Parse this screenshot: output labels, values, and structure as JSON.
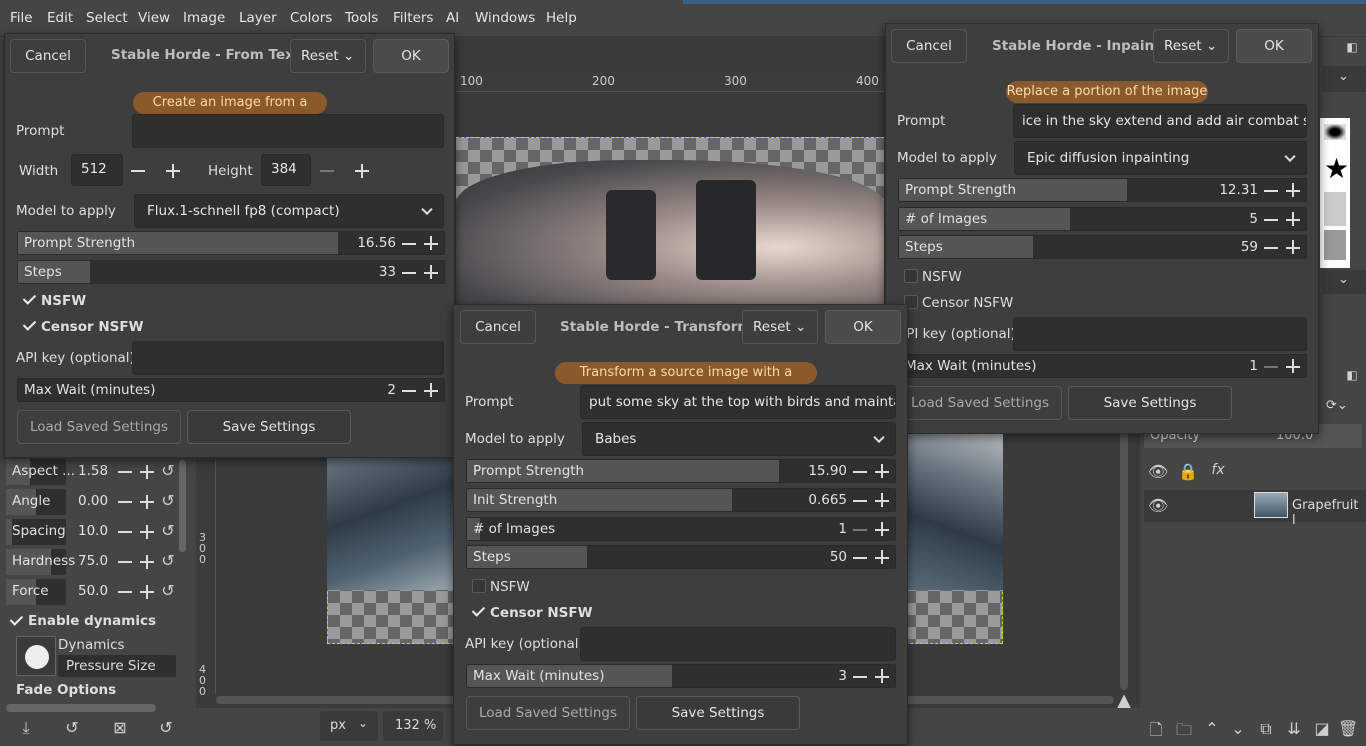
{
  "menubar": [
    "File",
    "Edit",
    "Select",
    "View",
    "Image",
    "Layer",
    "Colors",
    "Tools",
    "Filters",
    "AI",
    "Windows",
    "Help"
  ],
  "ruler": {
    "marks": [
      "100",
      "200",
      "300",
      "400"
    ],
    "vertical_marks": [
      "300",
      "400"
    ]
  },
  "statusbar": {
    "unit": "px",
    "zoom": "132 %"
  },
  "tool_options": {
    "rows": [
      {
        "label": "Aspect ...",
        "value": "1.58",
        "fill": 0.4
      },
      {
        "label": "Angle",
        "value": "0.00",
        "fill": 0.5
      },
      {
        "label": "Spacing",
        "value": "10.0",
        "fill": 0.1
      },
      {
        "label": "Hardness",
        "value": "75.0",
        "fill": 0.75
      },
      {
        "label": "Force",
        "value": "50.0",
        "fill": 0.5
      }
    ],
    "enable_dynamics": "Enable dynamics",
    "dynamics_label": "Dynamics",
    "dynamics_value": "Pressure Size",
    "fade_options": "Fade Options"
  },
  "layers": {
    "opacity_label": "Opacity",
    "opacity_value": "100.0",
    "layer_name": "Grapefruit l"
  },
  "dialog_text": {
    "cancel": "Cancel",
    "reset": "Reset",
    "ok": "OK",
    "title": "Stable Horde - From Text",
    "pill": "Create an image from a prompt",
    "prompt_label": "Prompt",
    "prompt_value": "",
    "width_label": "Width",
    "width_value": "512",
    "height_label": "Height",
    "height_value": "384",
    "model_label": "Model to apply",
    "model_value": "Flux.1-schnell fp8 (compact)",
    "prompt_strength_label": "Prompt Strength",
    "prompt_strength_value": "16.56",
    "prompt_strength_fill": 0.72,
    "steps_label": "Steps",
    "steps_value": "33",
    "steps_fill": 0.17,
    "nsfw": "NSFW",
    "censor": "Censor NSFW",
    "api_label": "API key (optional)",
    "api_value": "",
    "maxwait_label": "Max Wait (minutes)",
    "maxwait_value": "2",
    "load": "Load Saved Settings",
    "save": "Save Settings"
  },
  "dialog_inpaint": {
    "cancel": "Cancel",
    "reset": "Reset",
    "ok": "OK",
    "title": "Stable Horde - Inpaint",
    "pill": "Replace a portion of the image",
    "prompt_label": "Prompt",
    "prompt_value": "ice in the sky extend and add air combat ships",
    "model_label": "Model to apply",
    "model_value": "Epic diffusion inpainting",
    "prompt_strength_label": "Prompt Strength",
    "prompt_strength_value": "12.31",
    "prompt_strength_fill": 0.56,
    "images_label": "# of Images",
    "images_value": "5",
    "images_fill": 0.42,
    "steps_label": "Steps",
    "steps_value": "59",
    "steps_fill": 0.33,
    "nsfw": "NSFW",
    "censor": "Censor NSFW",
    "api_label": "API key (optional)",
    "api_value": "",
    "maxwait_label": "Max Wait (minutes)",
    "maxwait_value": "1",
    "load": "Load Saved Settings",
    "save": "Save Settings"
  },
  "dialog_transform": {
    "cancel": "Cancel",
    "reset": "Reset",
    "ok": "OK",
    "title": "Stable Horde - Transform",
    "pill": "Transform a source image with a prompt",
    "prompt_label": "Prompt",
    "prompt_value": "put some sky at the top with birds and maintain a",
    "model_label": "Model to apply",
    "model_value": "Babes",
    "prompt_strength_label": "Prompt Strength",
    "prompt_strength_value": "15.90",
    "prompt_strength_fill": 0.73,
    "init_label": "Init Strength",
    "init_value": "0.665",
    "init_fill": 0.6,
    "images_label": "# of Images",
    "images_value": "1",
    "images_fill": 0.03,
    "steps_label": "Steps",
    "steps_value": "50",
    "steps_fill": 0.28,
    "nsfw": "NSFW",
    "censor": "Censor NSFW",
    "api_label": "API key (optional)",
    "api_value": "",
    "maxwait_label": "Max Wait (minutes)",
    "maxwait_value": "3",
    "load": "Load Saved Settings",
    "save": "Save Settings"
  }
}
